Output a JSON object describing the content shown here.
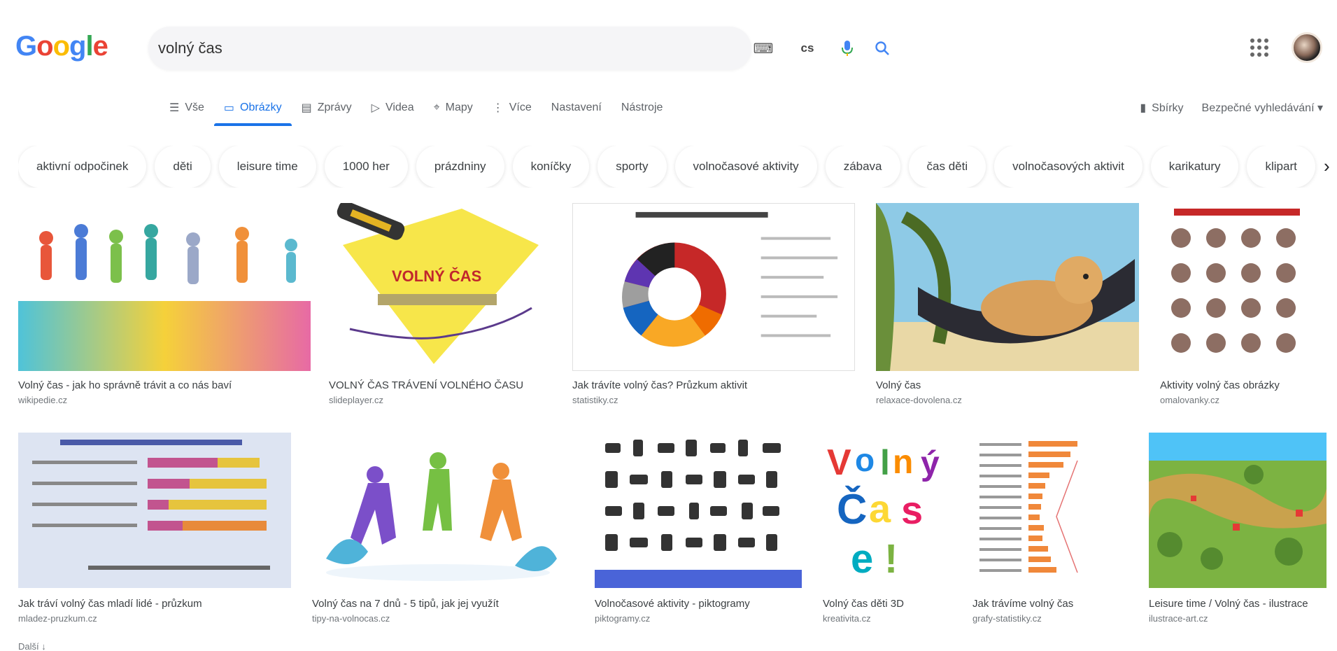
{
  "logo": "Google",
  "search": {
    "query": "volný čas",
    "lang": "cs"
  },
  "tabs": [
    {
      "label": "Vše",
      "icon": "☰"
    },
    {
      "label": "Obrázky",
      "icon": "▭"
    },
    {
      "label": "Zprávy",
      "icon": "▤"
    },
    {
      "label": "Videa",
      "icon": "▷"
    },
    {
      "label": "Mapy",
      "icon": "⌖"
    },
    {
      "label": "Více",
      "icon": "⋮"
    },
    {
      "label": "Nastavení",
      "icon": ""
    },
    {
      "label": "Nástroje",
      "icon": ""
    }
  ],
  "tools_right": {
    "collection": "Sbírky",
    "safesearch": "Bezpečné vyhledávání"
  },
  "chips": [
    "aktivní odpočinek",
    "děti",
    "leisure time",
    "1000 her",
    "prázdniny",
    "koníčky",
    "sporty",
    "volnočasové aktivity",
    "zábava",
    "čas děti",
    "volnočasových aktivit",
    "karikatury",
    "klipart"
  ],
  "results": [
    {
      "title": "Volný čas - jak ho správně trávit a co nás baví",
      "source": "wikipedie.cz"
    },
    {
      "title": "VOLNÝ ČAS TRÁVENÍ VOLNÉHO ČASU",
      "source": "slideplayer.cz"
    },
    {
      "title": "Jak trávíte volný čas? Průzkum aktivit",
      "source": "statistiky.cz"
    },
    {
      "title": "Volný čas",
      "source": "relaxace-dovolena.cz"
    },
    {
      "title": "Aktivity volný čas obrázky",
      "source": "omalovanky.cz"
    },
    {
      "title": "Jak tráví volný čas mladí lidé - průzkum",
      "source": "mladez-pruzkum.cz"
    },
    {
      "title": "Volný čas na 7 dnů - 5 tipů, jak jej využít",
      "source": "tipy-na-volnocas.cz"
    },
    {
      "title": "Volnočasové aktivity - piktogramy",
      "source": "piktogramy.cz"
    },
    {
      "title": "Volný čas děti 3D",
      "source": "kreativita.cz"
    },
    {
      "title": "Jak trávíme volný čas",
      "source": "grafy-statistiky.cz"
    },
    {
      "title": "Leisure time / Volný čas - ilustrace",
      "source": "ilustrace-art.cz"
    }
  ],
  "footer": "Další ↓"
}
